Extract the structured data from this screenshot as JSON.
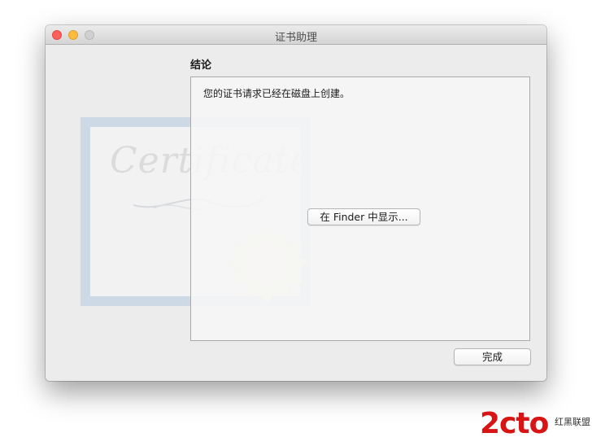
{
  "window": {
    "title": "证书助理"
  },
  "content": {
    "heading": "结论",
    "message": "您的证书请求已经在磁盘上创建。",
    "show_in_finder_label": "在 Finder 中显示...",
    "done_label": "完成"
  },
  "illustration": {
    "certificate_text": "Certificate"
  },
  "watermark": {
    "logo_text": "2cto",
    "caption": "红黑联盟"
  }
}
